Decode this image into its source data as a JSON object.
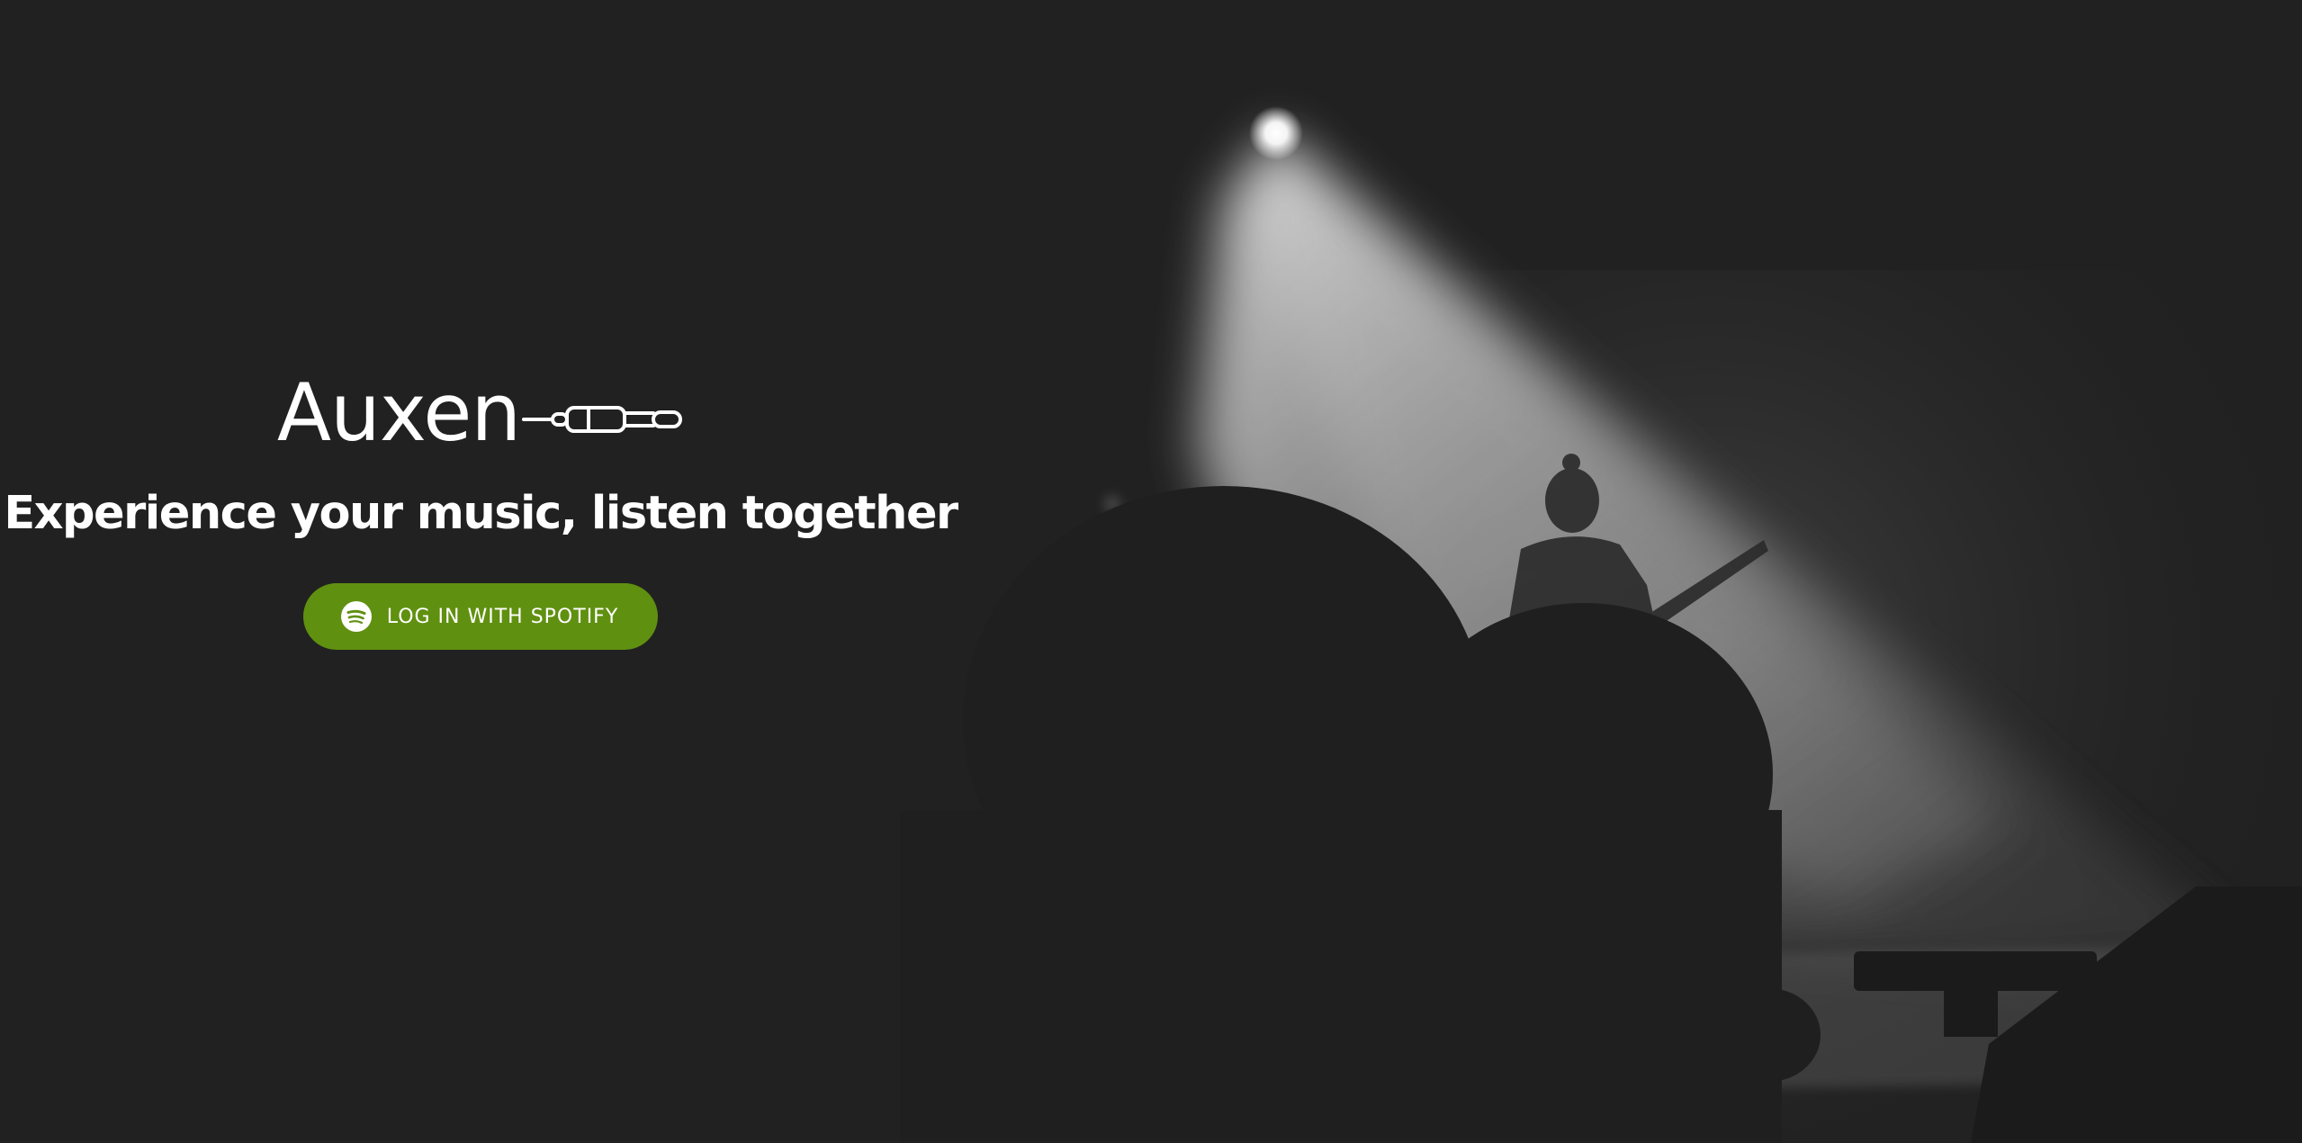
{
  "app": {
    "name": "Auxen"
  },
  "hero": {
    "tagline": "Experience your music, listen together",
    "login_label": "LOG IN WITH SPOTIFY"
  },
  "icons": {
    "brand": "aux-cable-icon",
    "login": "spotify-icon"
  },
  "colors": {
    "background": "#212121",
    "accent": "#609010",
    "text": "#ffffff"
  }
}
